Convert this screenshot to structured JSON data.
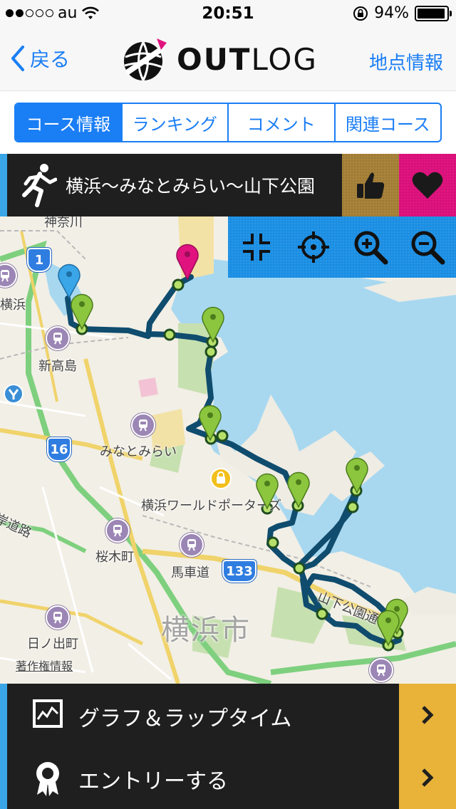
{
  "status": {
    "carrier": "au",
    "time": "20:51",
    "battery": "94%",
    "battery_level": 0.94
  },
  "nav": {
    "back_label": "戻る",
    "logo_bold": "OUT",
    "logo_light": "LOG",
    "right_label": "地点情報"
  },
  "tabs": [
    {
      "label": "コース情報",
      "active": true
    },
    {
      "label": "ランキング",
      "active": false
    },
    {
      "label": "コメント",
      "active": false
    },
    {
      "label": "関連コース",
      "active": false
    }
  ],
  "course": {
    "title": "横浜〜みなとみらい〜山下公園"
  },
  "map": {
    "labels": {
      "kanagawa": "神奈川",
      "yokohama": "横浜",
      "shintakashima": "新高島",
      "minatomirai": "みなとみらい",
      "worldporters": "横浜ワールドポーターズ",
      "sakuragicho": "桜木町",
      "bashamichi": "馬車道",
      "yamashita": "山下公園通り",
      "hinodecho": "日ノ出町",
      "city": "横浜市",
      "copyright": "著作権情報",
      "route_road": "岸道路"
    },
    "shields": {
      "r1": "1",
      "r16": "16",
      "r133": "133"
    },
    "colors": {
      "route": "#0f4c6e",
      "water": "#9fd4ef",
      "green_pin": "#8cc63f",
      "start_pin": "#3aa6e8",
      "goal_pin": "#e0137f"
    }
  },
  "menu": [
    {
      "label": "グラフ＆ラップタイム",
      "icon": "graph-icon"
    },
    {
      "label": "エントリーする",
      "icon": "medal-icon"
    }
  ]
}
